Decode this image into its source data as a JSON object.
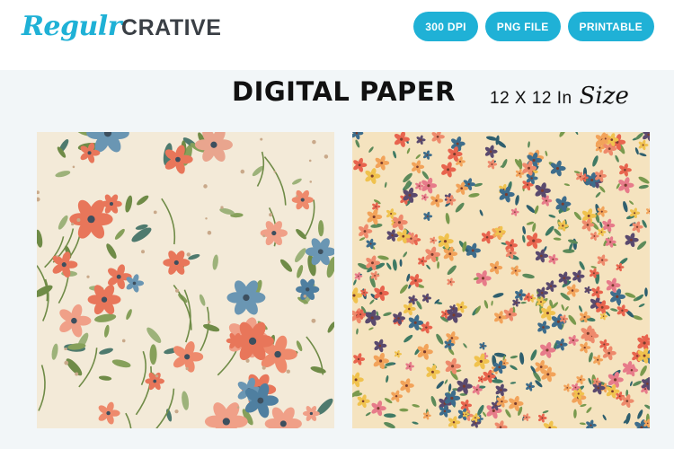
{
  "brand": {
    "script_part": "Regulr",
    "bold_part": "CRATIVE",
    "accent_color": "#1fb1d6"
  },
  "badges": [
    "300 DPI",
    "PNG FILE",
    "PRINTABLE"
  ],
  "heading": {
    "title": "DIGITAL PAPER",
    "size_text": "12 X 12 In",
    "size_script": "Size"
  },
  "papers": [
    {
      "name": "large-floral-pattern",
      "background": "#f3ead8"
    },
    {
      "name": "ditsy-floral-pattern",
      "background": "#f5e3bf"
    }
  ]
}
